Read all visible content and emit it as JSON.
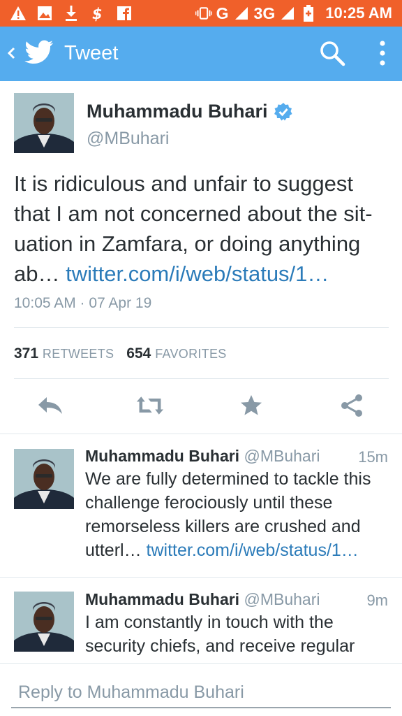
{
  "status_bar": {
    "network": "G",
    "network_3g": "3G",
    "time": "10:25 AM"
  },
  "app_bar": {
    "title": "Tweet",
    "icons": [
      "back-chevron-icon",
      "twitter-bird-icon",
      "search-icon",
      "more-vert-icon"
    ]
  },
  "colors": {
    "status_bar": "#f0602a",
    "app_bar": "#55acee",
    "link": "#2b7bb9",
    "muted": "#8899a6"
  },
  "main_tweet": {
    "author_name": "Muhammadu Buhari",
    "author_handle": "@MBuhari",
    "verified": true,
    "text": "It is ridiculous and unfair to suggest that I am not concerned about the sit- uation in Zamfara, or doing anything ab… ",
    "link": "twitter.com/i/web/status/1…",
    "timestamp": "10:05 AM · 07 Apr 19",
    "retweets_count": "371",
    "retweets_label": "RETWEETS",
    "favorites_count": "654",
    "favorites_label": "FAVORITES",
    "actions": [
      "reply-icon",
      "retweet-icon",
      "favorite-icon",
      "share-icon"
    ]
  },
  "replies": [
    {
      "author_name": "Muhammadu Buhari",
      "author_handle": "@MBuhari",
      "time": "15m",
      "text": "We are fully determined to tackle this challenge ferociously until these remorseless killers are crushed and utterl… ",
      "link": "twitter.com/i/web/status/1…"
    },
    {
      "author_name": "Muhammadu Buhari",
      "author_handle": "@MBuhari",
      "time": "9m",
      "text": "I am constantly in touch with the security chiefs, and receive regular",
      "link": ""
    }
  ],
  "reply_bar": {
    "placeholder": "Reply to Muhammadu Buhari"
  }
}
